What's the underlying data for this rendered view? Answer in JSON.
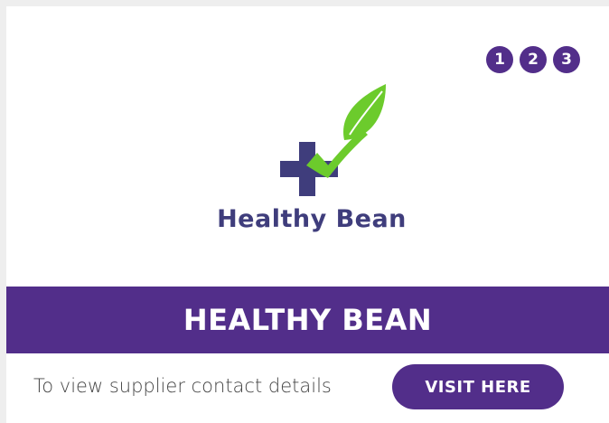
{
  "colors": {
    "brand_purple": "#522e8a",
    "logo_purple": "#3f3d7c",
    "leaf_green": "#6ccb2c",
    "background": "#eeeeee",
    "card": "#ffffff"
  },
  "pager": {
    "items": [
      "1",
      "2",
      "3"
    ]
  },
  "logo": {
    "icon": "plus-leaf-logo-icon",
    "text": "Healthy Bean"
  },
  "banner": {
    "title": "HEALTHY BEAN"
  },
  "footer": {
    "text": "To view supplier contact details",
    "button_label": "VISIT HERE"
  }
}
